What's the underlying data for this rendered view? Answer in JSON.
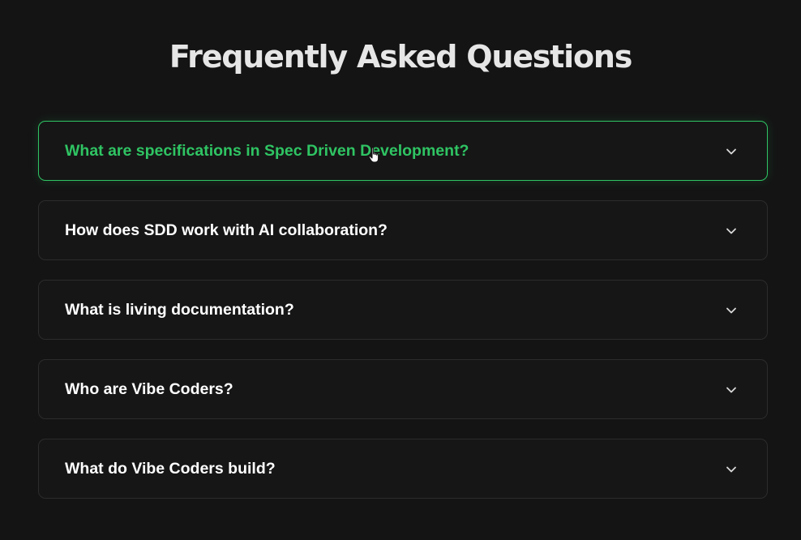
{
  "faq": {
    "title": "Frequently Asked Questions",
    "items": [
      {
        "question": "What are specifications in Spec Driven Development?",
        "active": true
      },
      {
        "question": "How does SDD work with AI collaboration?",
        "active": false
      },
      {
        "question": "What is living documentation?",
        "active": false
      },
      {
        "question": "Who are Vibe Coders?",
        "active": false
      },
      {
        "question": "What do Vibe Coders build?",
        "active": false
      }
    ]
  },
  "colors": {
    "background": "#141414",
    "accent": "#2fc463",
    "text": "#ffffff",
    "border": "#2c2c2c"
  },
  "icons": {
    "expand": "chevron-down-icon",
    "cursor": "hand-pointer-icon"
  }
}
